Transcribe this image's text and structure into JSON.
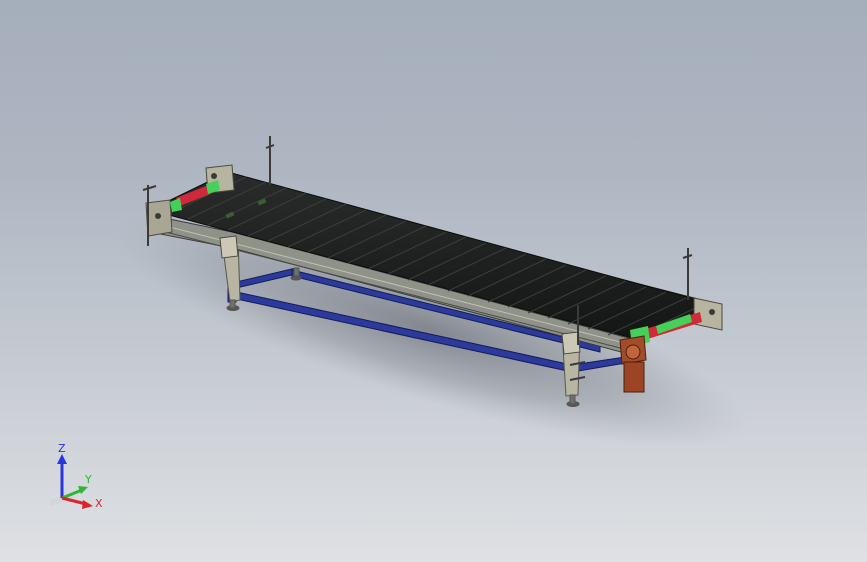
{
  "viewport": {
    "background_top": "#a5aebb",
    "background_bottom": "#dfe1e4"
  },
  "model": {
    "belt_color": "#1d1f1e",
    "frame_color": "#8f9289",
    "base_color": "#2b3a9c",
    "drive_color": "#a24d2a",
    "guide_color": "#45d05a",
    "accent_red": "#d02a3a"
  },
  "triad": {
    "z_label": "Z",
    "y_label": "Y",
    "x_label": "X",
    "z_color": "#2a35e0",
    "y_color": "#2db536",
    "x_color": "#d9242e"
  }
}
